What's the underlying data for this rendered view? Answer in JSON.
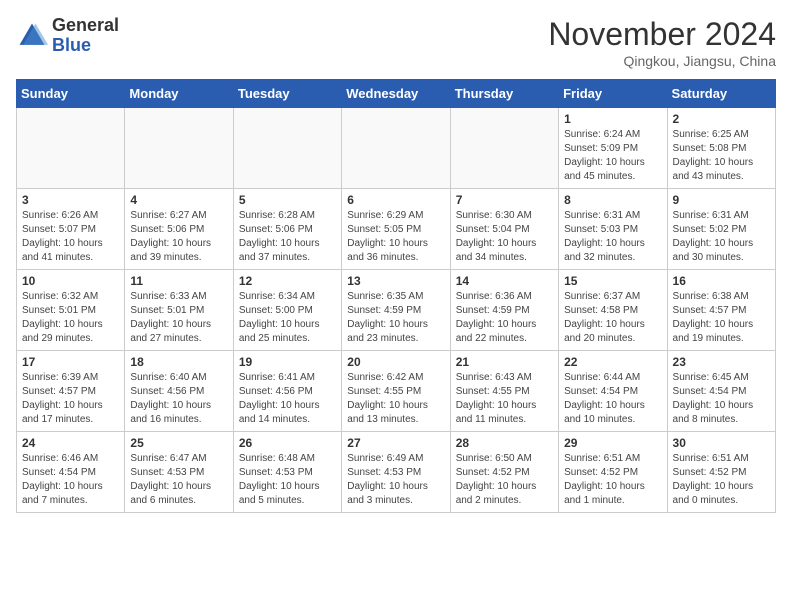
{
  "header": {
    "logo_line1": "General",
    "logo_line2": "Blue",
    "month": "November 2024",
    "location": "Qingkou, Jiangsu, China"
  },
  "weekdays": [
    "Sunday",
    "Monday",
    "Tuesday",
    "Wednesday",
    "Thursday",
    "Friday",
    "Saturday"
  ],
  "weeks": [
    [
      {
        "day": "",
        "info": ""
      },
      {
        "day": "",
        "info": ""
      },
      {
        "day": "",
        "info": ""
      },
      {
        "day": "",
        "info": ""
      },
      {
        "day": "",
        "info": ""
      },
      {
        "day": "1",
        "info": "Sunrise: 6:24 AM\nSunset: 5:09 PM\nDaylight: 10 hours\nand 45 minutes."
      },
      {
        "day": "2",
        "info": "Sunrise: 6:25 AM\nSunset: 5:08 PM\nDaylight: 10 hours\nand 43 minutes."
      }
    ],
    [
      {
        "day": "3",
        "info": "Sunrise: 6:26 AM\nSunset: 5:07 PM\nDaylight: 10 hours\nand 41 minutes."
      },
      {
        "day": "4",
        "info": "Sunrise: 6:27 AM\nSunset: 5:06 PM\nDaylight: 10 hours\nand 39 minutes."
      },
      {
        "day": "5",
        "info": "Sunrise: 6:28 AM\nSunset: 5:06 PM\nDaylight: 10 hours\nand 37 minutes."
      },
      {
        "day": "6",
        "info": "Sunrise: 6:29 AM\nSunset: 5:05 PM\nDaylight: 10 hours\nand 36 minutes."
      },
      {
        "day": "7",
        "info": "Sunrise: 6:30 AM\nSunset: 5:04 PM\nDaylight: 10 hours\nand 34 minutes."
      },
      {
        "day": "8",
        "info": "Sunrise: 6:31 AM\nSunset: 5:03 PM\nDaylight: 10 hours\nand 32 minutes."
      },
      {
        "day": "9",
        "info": "Sunrise: 6:31 AM\nSunset: 5:02 PM\nDaylight: 10 hours\nand 30 minutes."
      }
    ],
    [
      {
        "day": "10",
        "info": "Sunrise: 6:32 AM\nSunset: 5:01 PM\nDaylight: 10 hours\nand 29 minutes."
      },
      {
        "day": "11",
        "info": "Sunrise: 6:33 AM\nSunset: 5:01 PM\nDaylight: 10 hours\nand 27 minutes."
      },
      {
        "day": "12",
        "info": "Sunrise: 6:34 AM\nSunset: 5:00 PM\nDaylight: 10 hours\nand 25 minutes."
      },
      {
        "day": "13",
        "info": "Sunrise: 6:35 AM\nSunset: 4:59 PM\nDaylight: 10 hours\nand 23 minutes."
      },
      {
        "day": "14",
        "info": "Sunrise: 6:36 AM\nSunset: 4:59 PM\nDaylight: 10 hours\nand 22 minutes."
      },
      {
        "day": "15",
        "info": "Sunrise: 6:37 AM\nSunset: 4:58 PM\nDaylight: 10 hours\nand 20 minutes."
      },
      {
        "day": "16",
        "info": "Sunrise: 6:38 AM\nSunset: 4:57 PM\nDaylight: 10 hours\nand 19 minutes."
      }
    ],
    [
      {
        "day": "17",
        "info": "Sunrise: 6:39 AM\nSunset: 4:57 PM\nDaylight: 10 hours\nand 17 minutes."
      },
      {
        "day": "18",
        "info": "Sunrise: 6:40 AM\nSunset: 4:56 PM\nDaylight: 10 hours\nand 16 minutes."
      },
      {
        "day": "19",
        "info": "Sunrise: 6:41 AM\nSunset: 4:56 PM\nDaylight: 10 hours\nand 14 minutes."
      },
      {
        "day": "20",
        "info": "Sunrise: 6:42 AM\nSunset: 4:55 PM\nDaylight: 10 hours\nand 13 minutes."
      },
      {
        "day": "21",
        "info": "Sunrise: 6:43 AM\nSunset: 4:55 PM\nDaylight: 10 hours\nand 11 minutes."
      },
      {
        "day": "22",
        "info": "Sunrise: 6:44 AM\nSunset: 4:54 PM\nDaylight: 10 hours\nand 10 minutes."
      },
      {
        "day": "23",
        "info": "Sunrise: 6:45 AM\nSunset: 4:54 PM\nDaylight: 10 hours\nand 8 minutes."
      }
    ],
    [
      {
        "day": "24",
        "info": "Sunrise: 6:46 AM\nSunset: 4:54 PM\nDaylight: 10 hours\nand 7 minutes."
      },
      {
        "day": "25",
        "info": "Sunrise: 6:47 AM\nSunset: 4:53 PM\nDaylight: 10 hours\nand 6 minutes."
      },
      {
        "day": "26",
        "info": "Sunrise: 6:48 AM\nSunset: 4:53 PM\nDaylight: 10 hours\nand 5 minutes."
      },
      {
        "day": "27",
        "info": "Sunrise: 6:49 AM\nSunset: 4:53 PM\nDaylight: 10 hours\nand 3 minutes."
      },
      {
        "day": "28",
        "info": "Sunrise: 6:50 AM\nSunset: 4:52 PM\nDaylight: 10 hours\nand 2 minutes."
      },
      {
        "day": "29",
        "info": "Sunrise: 6:51 AM\nSunset: 4:52 PM\nDaylight: 10 hours\nand 1 minute."
      },
      {
        "day": "30",
        "info": "Sunrise: 6:51 AM\nSunset: 4:52 PM\nDaylight: 10 hours\nand 0 minutes."
      }
    ]
  ]
}
